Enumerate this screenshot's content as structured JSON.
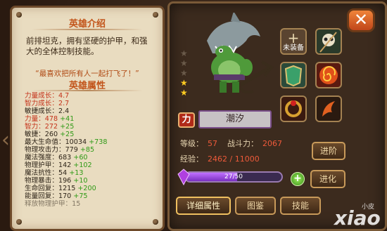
{
  "intro": {
    "title": "英雄介绍",
    "description": "前排坦克，拥有坚硬的护甲，和强大的全体控制技能。",
    "quote": "“最喜欢把所有人一起打飞了！”"
  },
  "attributes": {
    "title": "英雄属性",
    "growth": [
      {
        "label": "力量成长：",
        "value": "4.7",
        "highlight": true
      },
      {
        "label": "智力成长：",
        "value": "2.7",
        "highlight": true
      },
      {
        "label": "敏捷成长：",
        "value": "2.4",
        "highlight": false
      }
    ],
    "stats": [
      {
        "label": "力量：",
        "value": "478",
        "bonus": "+41"
      },
      {
        "label": "智力：",
        "value": "272",
        "bonus": "+25"
      },
      {
        "label": "敏捷：",
        "value": "260",
        "bonus": "+25"
      },
      {
        "label": "最大生命值：",
        "value": "10034",
        "bonus": "+738"
      },
      {
        "label": "物理攻击力：",
        "value": "779",
        "bonus": "+85"
      },
      {
        "label": "魔法强度：",
        "value": "683",
        "bonus": "+60"
      },
      {
        "label": "物理护甲：",
        "value": "142",
        "bonus": "+102"
      },
      {
        "label": "魔法抗性：",
        "value": "54",
        "bonus": "+13"
      },
      {
        "label": "物理暴击：",
        "value": "196",
        "bonus": "+10"
      },
      {
        "label": "生命回复：",
        "value": "1215",
        "bonus": "+200"
      },
      {
        "label": "能量回复：",
        "value": "170",
        "bonus": "+75"
      },
      {
        "label": "释放物理护甲：",
        "value": "15",
        "bonus": ""
      }
    ]
  },
  "hero": {
    "name": "潮汐",
    "type_badge": "力",
    "stars_total": 5,
    "stars_filled": 2,
    "level_label": "等级：",
    "level": "57",
    "power_label": "战斗力：",
    "power": "2067",
    "exp_label": "经验：",
    "exp": "2462 / 11000"
  },
  "equipment": [
    {
      "name": "unequipped-slot",
      "caption": "未装备",
      "icon": "plus-icon"
    },
    {
      "name": "skull-staff-slot",
      "caption": "",
      "icon": "skull-icon"
    },
    {
      "name": "armor-slot",
      "caption": "",
      "icon": "armor-icon"
    },
    {
      "name": "spiral-orb-slot",
      "caption": "",
      "icon": "spiral-icon"
    },
    {
      "name": "ring-slot",
      "caption": "",
      "icon": "ring-icon"
    },
    {
      "name": "dark-blade-slot",
      "caption": "",
      "icon": "flame-icon"
    }
  ],
  "soulstone": {
    "text": "27/50",
    "fraction": 0.54
  },
  "buttons": {
    "promote": "进阶",
    "evolve": "进化",
    "details": "详细属性",
    "codex": "图鉴",
    "skills": "技能"
  },
  "close": "✕",
  "watermark": "xiao",
  "watermark_small": "小皮"
}
